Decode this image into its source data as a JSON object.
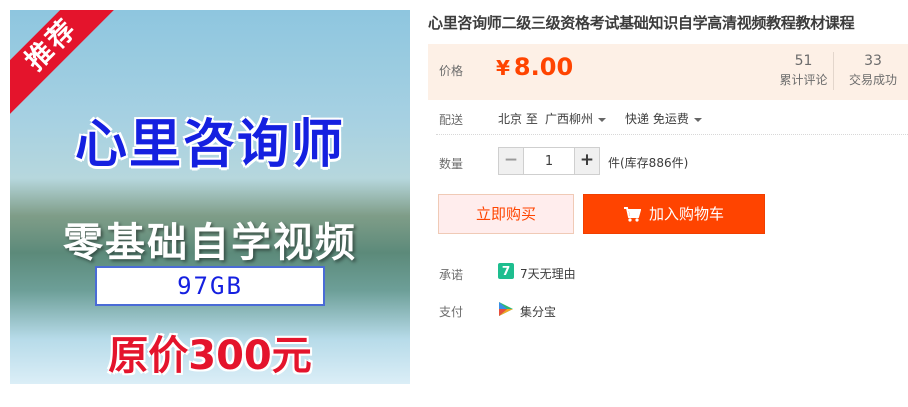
{
  "image": {
    "ribbon": "推荐",
    "title": "心里咨询师",
    "subtitle": "零基础自学视频",
    "size": "97GB",
    "original_price": "原价300元"
  },
  "product": {
    "title": "心里咨询师二级三级资格考试基础知识自学高清视频教程教材课程"
  },
  "price": {
    "label": "价格",
    "currency": "¥",
    "amount": "8.00",
    "reviews_count": "51",
    "reviews_label": "累计评论",
    "deals_count": "33",
    "deals_label": "交易成功"
  },
  "shipping": {
    "label": "配送",
    "from": "北京 至",
    "to": "广西柳州",
    "method": "快递 免运费"
  },
  "quantity": {
    "label": "数量",
    "minus": "−",
    "value": "1",
    "plus": "+",
    "stock": "件(库存886件)"
  },
  "buttons": {
    "buy_now": "立即购买",
    "add_to_cart": "加入购物车"
  },
  "promise": {
    "label": "承诺",
    "icon_text": "7",
    "text": "7天无理由"
  },
  "payment": {
    "label": "支付",
    "text": "集分宝"
  },
  "colors": {
    "accent": "#ff4400",
    "price_panel_bg": "#fdf0e6",
    "ribbon": "#e4142c",
    "promise_icon": "#1ebe8f"
  }
}
